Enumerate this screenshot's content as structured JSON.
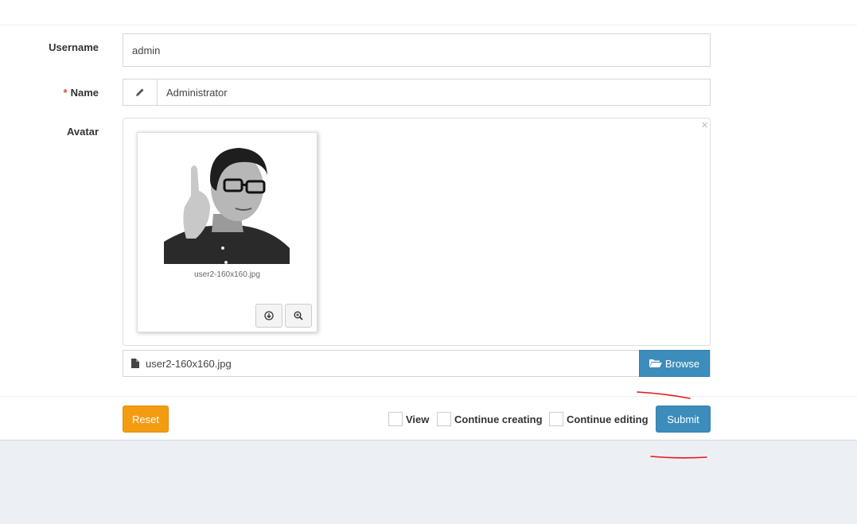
{
  "form": {
    "username": {
      "label": "Username",
      "value": "admin"
    },
    "name": {
      "required_mark": "*",
      "label": "Name",
      "value": "Administrator",
      "icon": "pencil-icon"
    },
    "avatar": {
      "label": "Avatar",
      "file_name": "user2-160x160.jpg",
      "close_glyph": "×",
      "browse_label": "Browse",
      "icons": {
        "download": "download-icon",
        "zoom": "zoom-in-icon",
        "file": "file-icon",
        "folder": "folder-open-icon"
      }
    }
  },
  "footer": {
    "reset_label": "Reset",
    "submit_label": "Submit",
    "checks": {
      "view": "View",
      "continue_creating": "Continue creating",
      "continue_editing": "Continue editing"
    }
  },
  "colors": {
    "primary": "#3c8dbc",
    "warning": "#f39c12",
    "required": "#dd4b39",
    "annotation": "#e8141b",
    "background": "#ecf0f5"
  }
}
